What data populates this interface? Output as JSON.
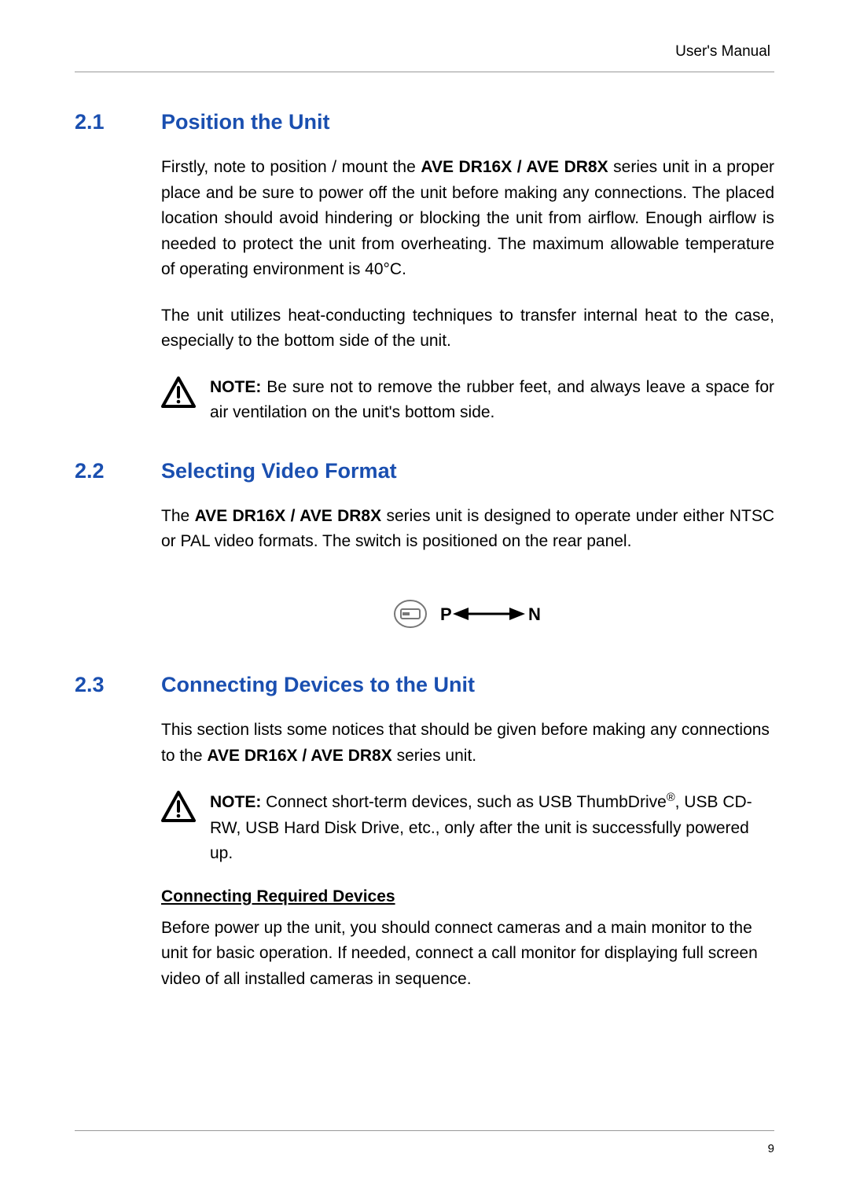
{
  "header": {
    "title": "User's Manual"
  },
  "sections": {
    "s21": {
      "number": "2.1",
      "title": "Position the Unit",
      "p1_a": "Firstly, note to position / mount the ",
      "p1_bold1": "AVE DR16X / AVE DR8X",
      "p1_b": " series unit in a proper place and be sure to power off the unit before making any connections. The placed location should avoid hindering or blocking the unit from airflow. Enough airflow is needed to protect the unit from overheating. The maximum allowable temperature of operating environment is 40°C.",
      "p2": "The unit utilizes heat-conducting techniques to transfer internal heat to the case, especially to the bottom side of the unit.",
      "note_label": "NOTE:",
      "note_text": " Be sure not to remove the rubber feet, and always leave a space for air ventilation on the unit's bottom side."
    },
    "s22": {
      "number": "2.2",
      "title": "Selecting Video Format",
      "p1_a": "The ",
      "p1_bold1": "AVE DR16X / AVE DR8X",
      "p1_b": " series unit is designed to operate under either NTSC or PAL video formats. The switch is positioned on the rear panel.",
      "switch_p": "P",
      "switch_n": "N"
    },
    "s23": {
      "number": "2.3",
      "title": "Connecting Devices to the Unit",
      "p1_a": "This section lists some notices that should be given before making any connections to the ",
      "p1_bold1": "AVE DR16X / AVE DR8X",
      "p1_b": " series unit.",
      "note_label": "NOTE:",
      "note_text_a": " Connect short-term devices, such as USB ThumbDrive",
      "note_sup": "®",
      "note_text_b": ", USB CD-RW, USB Hard Disk Drive, etc., only after the unit is successfully powered up.",
      "subheading": "Connecting Required Devices",
      "p2": "Before power up the unit, you should connect cameras and a main monitor to the unit for basic operation. If needed, connect a call monitor for displaying full screen video of all installed cameras in sequence."
    }
  },
  "footer": {
    "page_number": "9"
  }
}
